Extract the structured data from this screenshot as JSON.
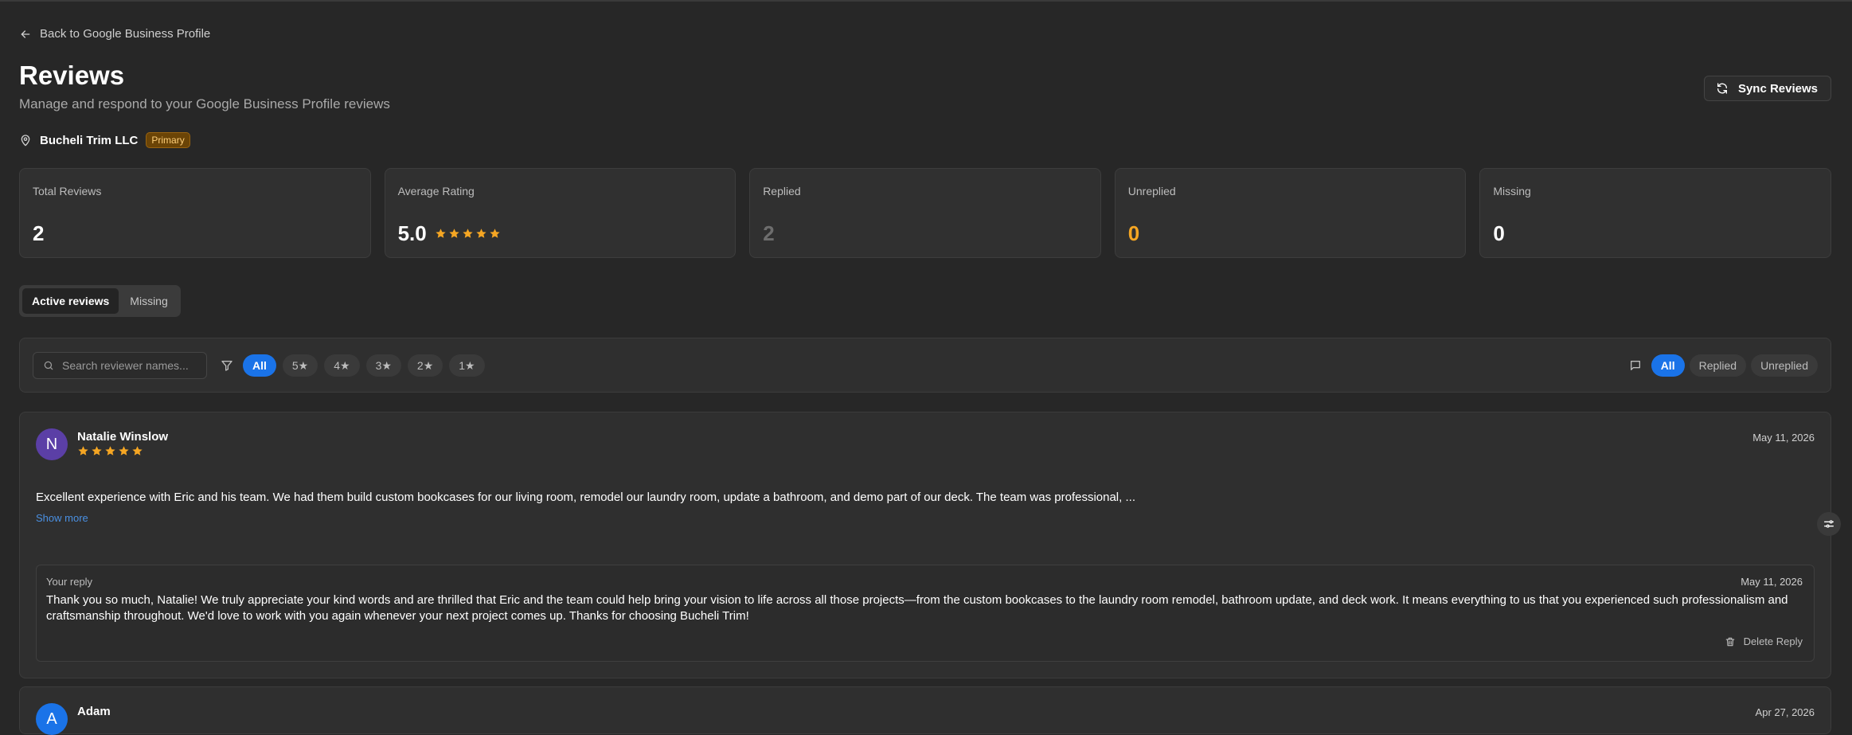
{
  "nav": {
    "back_label": "Back to Google Business Profile"
  },
  "header": {
    "title": "Reviews",
    "subtitle": "Manage and respond to your Google Business Profile reviews",
    "sync_label": "Sync Reviews"
  },
  "location": {
    "name": "Bucheli Trim LLC",
    "badge": "Primary"
  },
  "stats": {
    "total": {
      "label": "Total Reviews",
      "value": "2"
    },
    "average": {
      "label": "Average Rating",
      "value": "5.0",
      "stars": 5
    },
    "replied": {
      "label": "Replied",
      "value": "2"
    },
    "unreplied": {
      "label": "Unreplied",
      "value": "0"
    },
    "missing": {
      "label": "Missing",
      "value": "0"
    }
  },
  "view_toggle": {
    "active": "Active reviews",
    "missing": "Missing"
  },
  "filters": {
    "search_placeholder": "Search reviewer names...",
    "ratings": [
      "All",
      "5★",
      "4★",
      "3★",
      "2★",
      "1★"
    ],
    "reply_status": [
      "All",
      "Replied",
      "Unreplied"
    ]
  },
  "reviews": [
    {
      "initial": "N",
      "name": "Natalie Winslow",
      "stars": 5,
      "date": "May 11, 2026",
      "text": "Excellent experience with Eric and his team. We had them build custom bookcases for our living room, remodel our laundry room, update a bathroom, and demo part of our deck. The team was professional, ...",
      "show_more": "Show more",
      "reply": {
        "label": "Your reply",
        "date": "May 11, 2026",
        "text": "Thank you so much, Natalie! We truly appreciate your kind words and are thrilled that Eric and the team could help bring your vision to life across all those projects—from the custom bookcases to the laundry room remodel, bathroom update, and deck work. It means everything to us that you experienced such professionalism and craftsmanship throughout. We'd love to work with you again whenever your next project comes up. Thanks for choosing Bucheli Trim!",
        "delete_label": "Delete Reply"
      }
    },
    {
      "initial": "A",
      "name": "Adam",
      "date": "Apr 27, 2026"
    }
  ],
  "colors": {
    "background": "#272727",
    "accent_blue": "#1a73e8",
    "star_gold": "#f5a623",
    "avatar_purple": "#5b3fa6",
    "avatar_blue": "#1a73e8"
  },
  "icons": [
    "arrow-left-icon",
    "refresh-icon",
    "map-pin-icon",
    "star-icon",
    "search-icon",
    "filter-icon",
    "message-icon",
    "trash-icon"
  ]
}
